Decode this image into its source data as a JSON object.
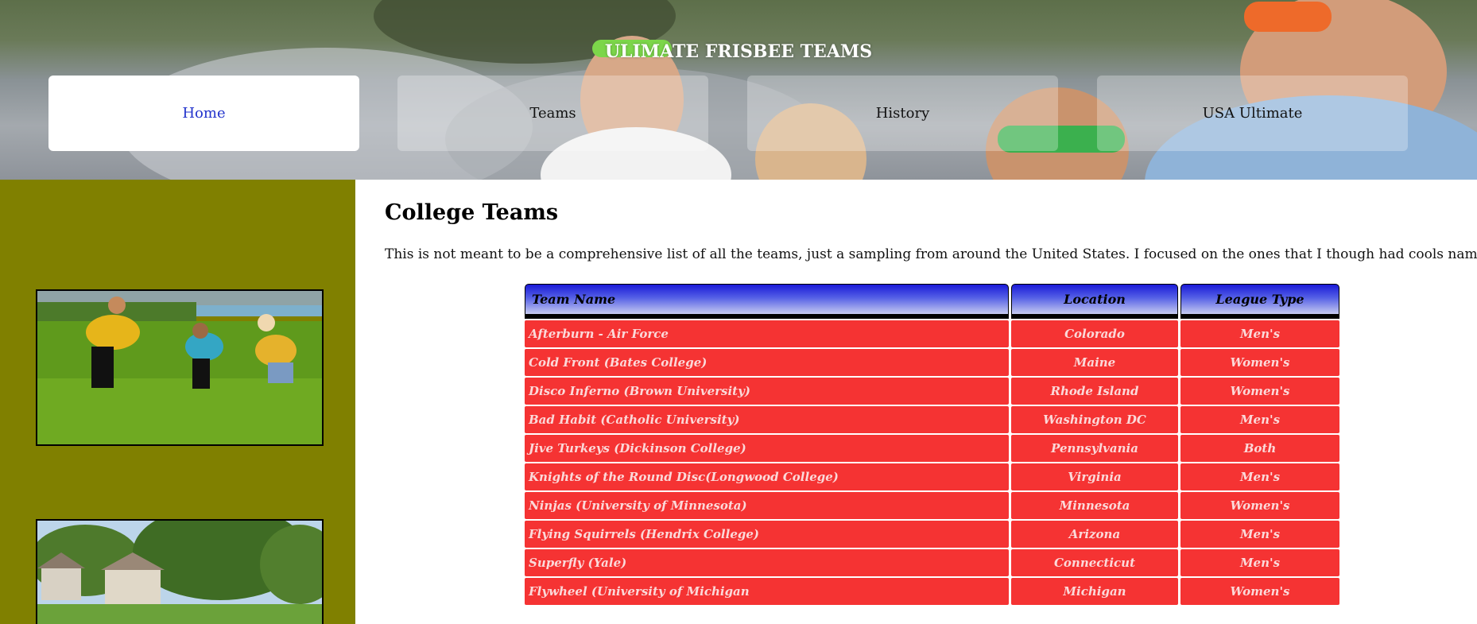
{
  "site_title": "ULIMATE FRISBEE TEAMS",
  "nav": [
    {
      "label": "Home",
      "active": true
    },
    {
      "label": "Teams",
      "active": false
    },
    {
      "label": "History",
      "active": false
    },
    {
      "label": "USA Ultimate",
      "active": false
    }
  ],
  "main": {
    "heading": "College Teams",
    "intro": "This is not meant to be a comprehensive list of all the teams, just a sampling from around the United States. I focused on the ones that I though had cools names."
  },
  "table": {
    "headers": [
      "Team Name",
      "Location",
      "League Type"
    ],
    "rows": [
      [
        "Afterburn - Air Force",
        "Colorado",
        "Men's"
      ],
      [
        "Cold Front (Bates College)",
        "Maine",
        "Women's"
      ],
      [
        "Disco Inferno (Brown University)",
        "Rhode Island",
        "Women's"
      ],
      [
        "Bad Habit (Catholic University)",
        "Washington DC",
        "Men's"
      ],
      [
        "Jive Turkeys (Dickinson College)",
        "Pennsylvania",
        "Both"
      ],
      [
        "Knights of the Round Disc(Longwood College)",
        "Virginia",
        "Men's"
      ],
      [
        "Ninjas (University of Minnesota)",
        "Minnesota",
        "Women's"
      ],
      [
        "Flying Squirrels (Hendrix College)",
        "Arizona",
        "Men's"
      ],
      [
        "Superfly (Yale)",
        "Connecticut",
        "Men's"
      ],
      [
        "Flywheel (University of Michigan",
        "Michigan",
        "Women's"
      ]
    ]
  },
  "colors": {
    "sidebar": "#808000",
    "table_cell": "#f53333",
    "header_gradient_top": "#1a1ad8",
    "active_nav_text": "#2233cc"
  }
}
